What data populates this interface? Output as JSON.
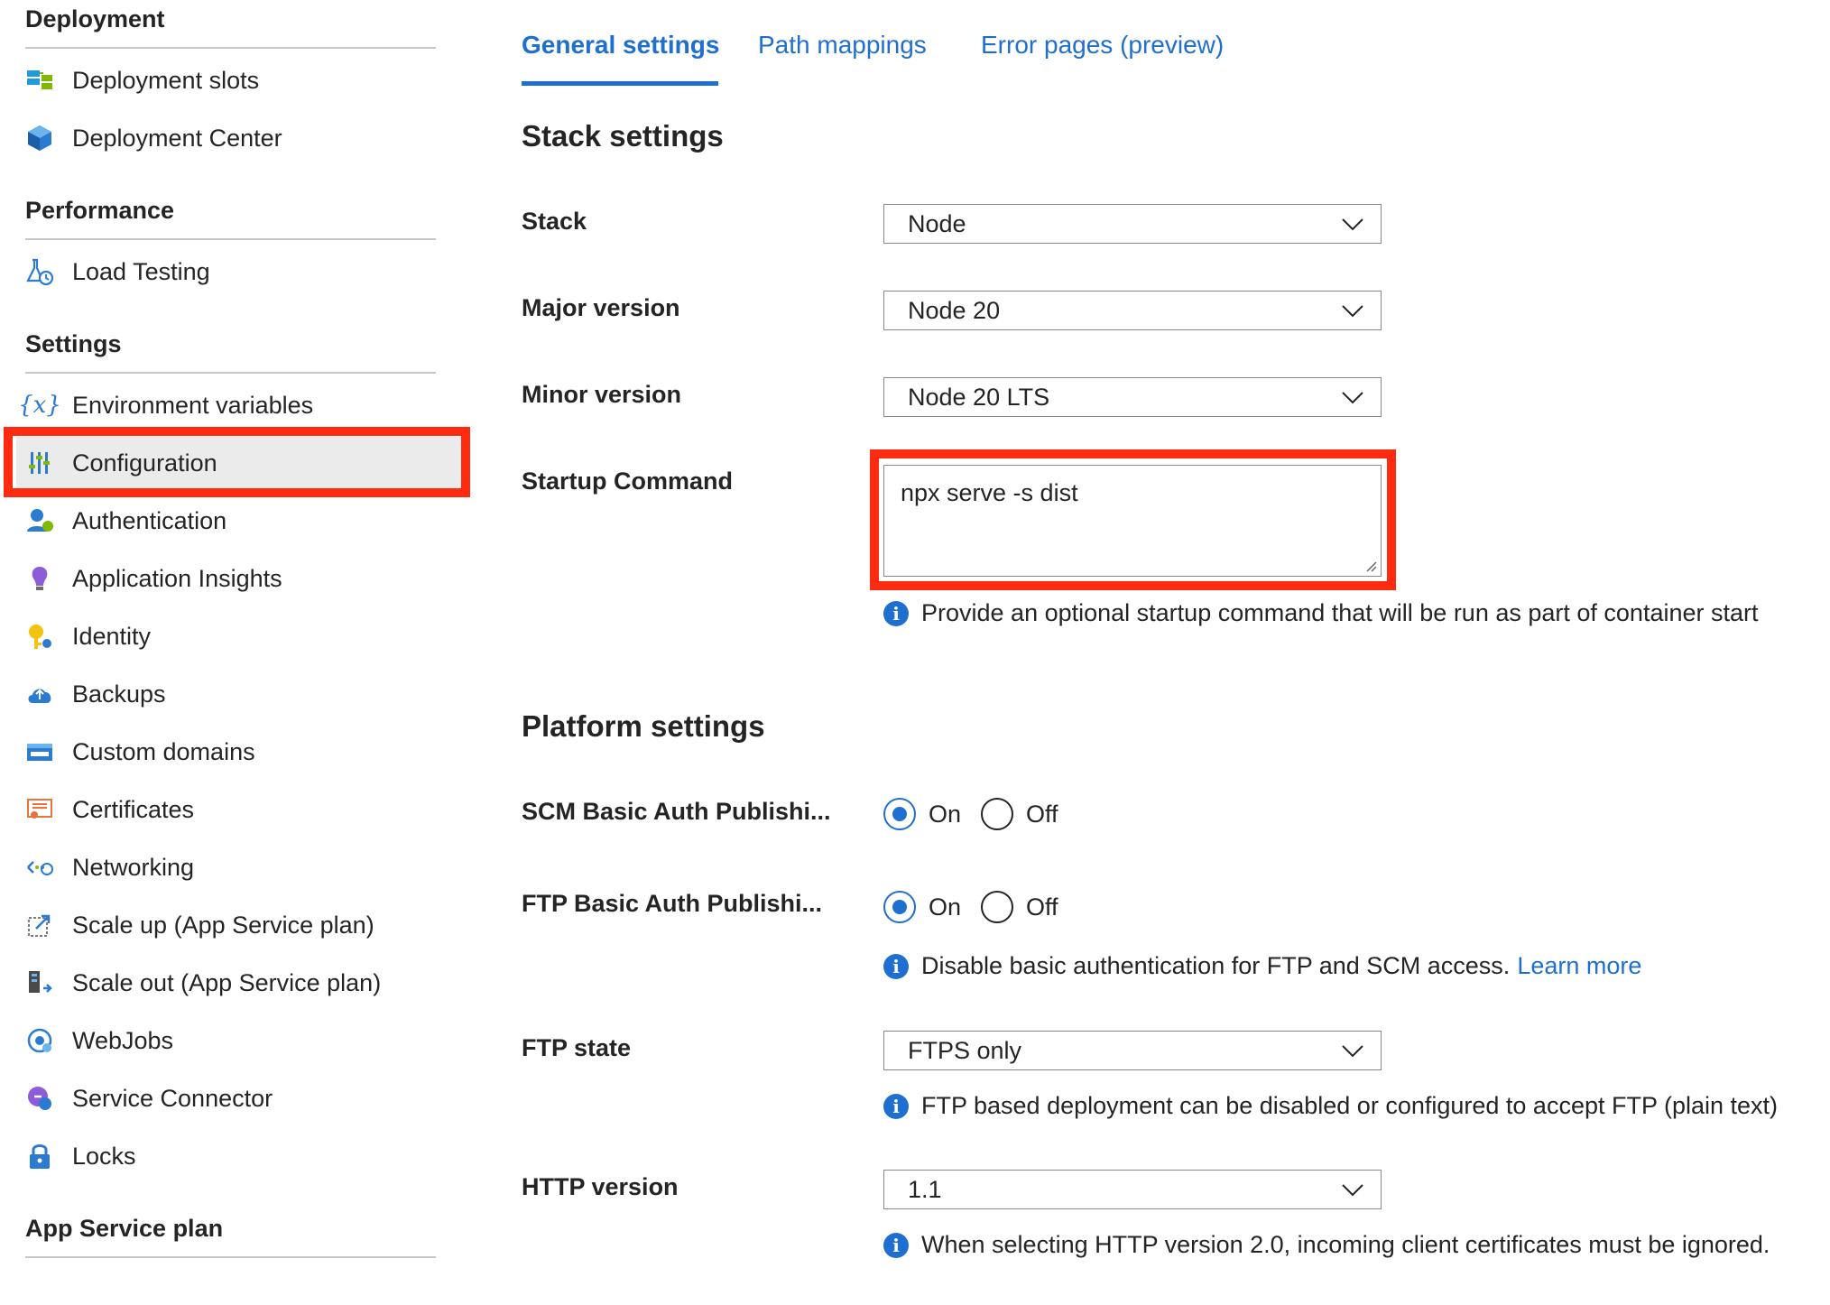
{
  "sidebar": {
    "deployment": {
      "header": "Deployment",
      "items": [
        {
          "label": "Deployment slots",
          "icon": "deployment-slots-icon"
        },
        {
          "label": "Deployment Center",
          "icon": "deployment-center-icon"
        }
      ]
    },
    "performance": {
      "header": "Performance",
      "items": [
        {
          "label": "Load Testing",
          "icon": "load-testing-icon"
        }
      ]
    },
    "settings": {
      "header": "Settings",
      "items": [
        {
          "label": "Environment variables",
          "icon": "environment-variables-icon"
        },
        {
          "label": "Configuration",
          "icon": "configuration-icon",
          "selected": true
        },
        {
          "label": "Authentication",
          "icon": "authentication-icon"
        },
        {
          "label": "Application Insights",
          "icon": "application-insights-icon"
        },
        {
          "label": "Identity",
          "icon": "identity-icon"
        },
        {
          "label": "Backups",
          "icon": "backups-icon"
        },
        {
          "label": "Custom domains",
          "icon": "custom-domains-icon"
        },
        {
          "label": "Certificates",
          "icon": "certificates-icon"
        },
        {
          "label": "Networking",
          "icon": "networking-icon"
        },
        {
          "label": "Scale up (App Service plan)",
          "icon": "scale-up-icon"
        },
        {
          "label": "Scale out (App Service plan)",
          "icon": "scale-out-icon"
        },
        {
          "label": "WebJobs",
          "icon": "webjobs-icon"
        },
        {
          "label": "Service Connector",
          "icon": "service-connector-icon"
        },
        {
          "label": "Locks",
          "icon": "lock-icon"
        }
      ]
    },
    "app_service_plan": {
      "header": "App Service plan"
    }
  },
  "tabs": [
    {
      "label": "General settings",
      "active": true
    },
    {
      "label": "Path mappings"
    },
    {
      "label": "Error pages (preview)"
    }
  ],
  "stack_settings": {
    "title": "Stack settings",
    "stack": {
      "label": "Stack",
      "value": "Node"
    },
    "major_version": {
      "label": "Major version",
      "value": "Node 20"
    },
    "minor_version": {
      "label": "Minor version",
      "value": "Node 20 LTS"
    },
    "startup_command": {
      "label": "Startup Command",
      "value": "npx serve -s dist",
      "info": "Provide an optional startup command that will be run as part of container start"
    }
  },
  "platform_settings": {
    "title": "Platform settings",
    "scm_basic_auth": {
      "label": "SCM Basic Auth Publishi...",
      "on_label": "On",
      "off_label": "Off",
      "selected": "On"
    },
    "ftp_basic_auth": {
      "label": "FTP Basic Auth Publishi...",
      "on_label": "On",
      "off_label": "Off",
      "selected": "On",
      "info": "Disable basic authentication for FTP and SCM access.",
      "info_link": "Learn more"
    },
    "ftp_state": {
      "label": "FTP state",
      "value": "FTPS only",
      "info": "FTP based deployment can be disabled or configured to accept FTP (plain text)"
    },
    "http_version": {
      "label": "HTTP version",
      "value": "1.1",
      "info": "When selecting HTTP version 2.0, incoming client certificates must be ignored."
    }
  },
  "colors": {
    "accent": "#1f6fd1",
    "highlight": "#ff2a12",
    "selected_bg": "#ebebeb"
  }
}
